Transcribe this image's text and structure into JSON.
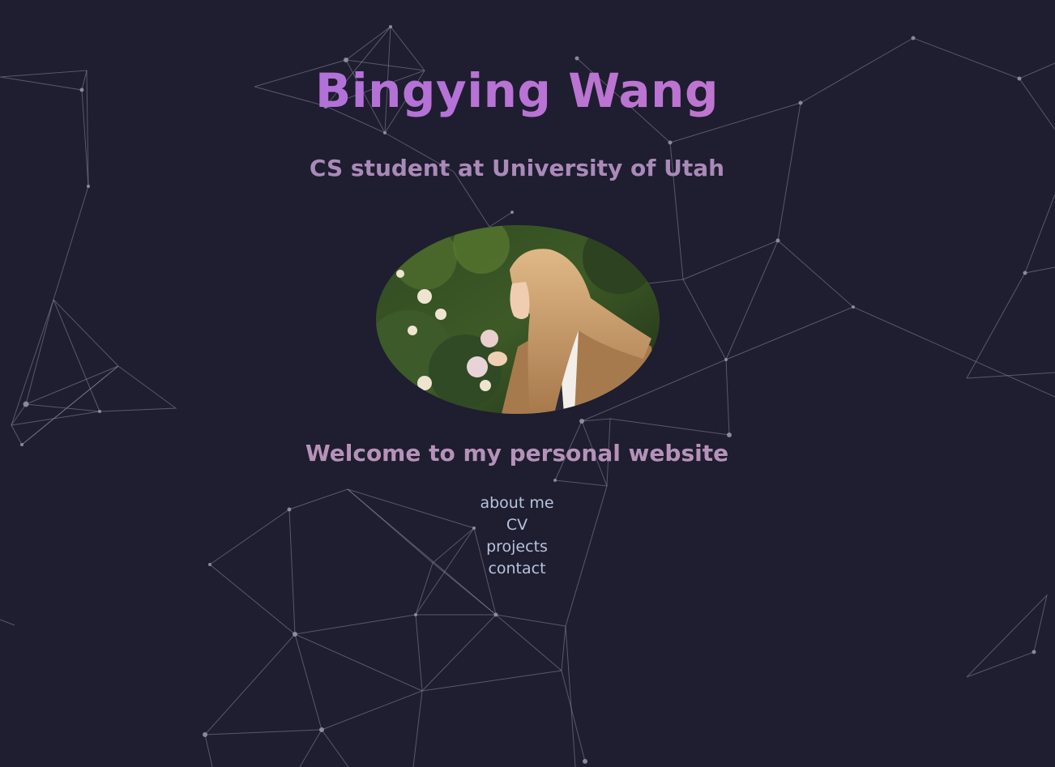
{
  "header": {
    "name": "Bingying Wang",
    "tagline": "CS student at University of Utah"
  },
  "main": {
    "welcome": "Welcome to my personal website"
  },
  "nav": {
    "items": [
      {
        "label": "about me"
      },
      {
        "label": "CV"
      },
      {
        "label": "projects"
      },
      {
        "label": "contact"
      }
    ]
  },
  "colors": {
    "background": "#1f1d30",
    "title": "#b070d6",
    "subtitle": "#a98ab8",
    "link": "#b7c3dc",
    "network_line": "#8a879c"
  }
}
